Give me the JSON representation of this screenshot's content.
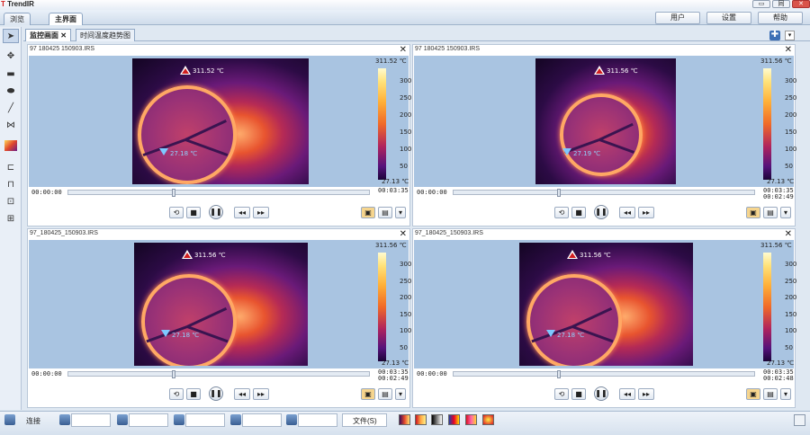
{
  "app": {
    "logo_prefix": "T",
    "logo_name": "TrendIR",
    "window_controls": [
      "▭",
      "同",
      "✕"
    ]
  },
  "top_tabs": [
    "浏览",
    "主界面"
  ],
  "top_buttons": [
    "用户",
    "设置",
    "帮助"
  ],
  "toolbox": [
    "select-icon",
    "move-icon",
    "rectangle-icon",
    "ellipse-icon",
    "line-icon",
    "polyline-icon",
    "palette-icon",
    "tool-a-icon",
    "tool-b-icon",
    "tool-c-icon",
    "tool-d-icon"
  ],
  "doc_tabs": [
    {
      "label": "监控画面",
      "close": "✕"
    },
    {
      "label": "时间温度趋势图"
    }
  ],
  "panels": [
    {
      "title": "97  180425  150903.IRS",
      "max": "311.52 ℃",
      "min": "27.13 ℃",
      "hot": "311.52 ℃",
      "cold": "27.18 ℃",
      "t_start": "00:00:00",
      "t_end": [
        "00:03:35"
      ],
      "progress": 0.35,
      "ticks": [
        "300",
        "250",
        "200",
        "150",
        "100",
        "50"
      ]
    },
    {
      "title": "97  180425  150903.IRS",
      "max": "311.56 ℃",
      "min": "27.13 ℃",
      "hot": "311.56 ℃",
      "cold": "27.19 ℃",
      "t_start": "00:00:00",
      "t_end": [
        "00:03:35",
        "00:02:49"
      ],
      "progress": 0.35,
      "ticks": [
        "300",
        "250",
        "200",
        "150",
        "100",
        "50"
      ]
    },
    {
      "title": "97_180425_150903.IRS",
      "max": "311.56 ℃",
      "min": "27.13 ℃",
      "hot": "311.56 ℃",
      "cold": "27.18 ℃",
      "t_start": "00:00:00",
      "t_end": [
        "00:03:35",
        "00:02:49"
      ],
      "progress": 0.35,
      "ticks": [
        "300",
        "250",
        "200",
        "150",
        "100",
        "50"
      ]
    },
    {
      "title": "97_180425_150903.IRS",
      "max": "311.56 ℃",
      "min": "27.13 ℃",
      "hot": "311.56 ℃",
      "cold": "27.18 ℃",
      "t_start": "00:00:00",
      "t_end": [
        "00:03:35",
        "00:02:48"
      ],
      "progress": 0.35,
      "ticks": [
        "300",
        "250",
        "200",
        "150",
        "100",
        "50"
      ]
    }
  ],
  "status": {
    "connect": "连接",
    "file": "文件(S)"
  },
  "colors": {
    "accent": "#3d6fb5",
    "stage_bg": "#a9c4e1"
  }
}
